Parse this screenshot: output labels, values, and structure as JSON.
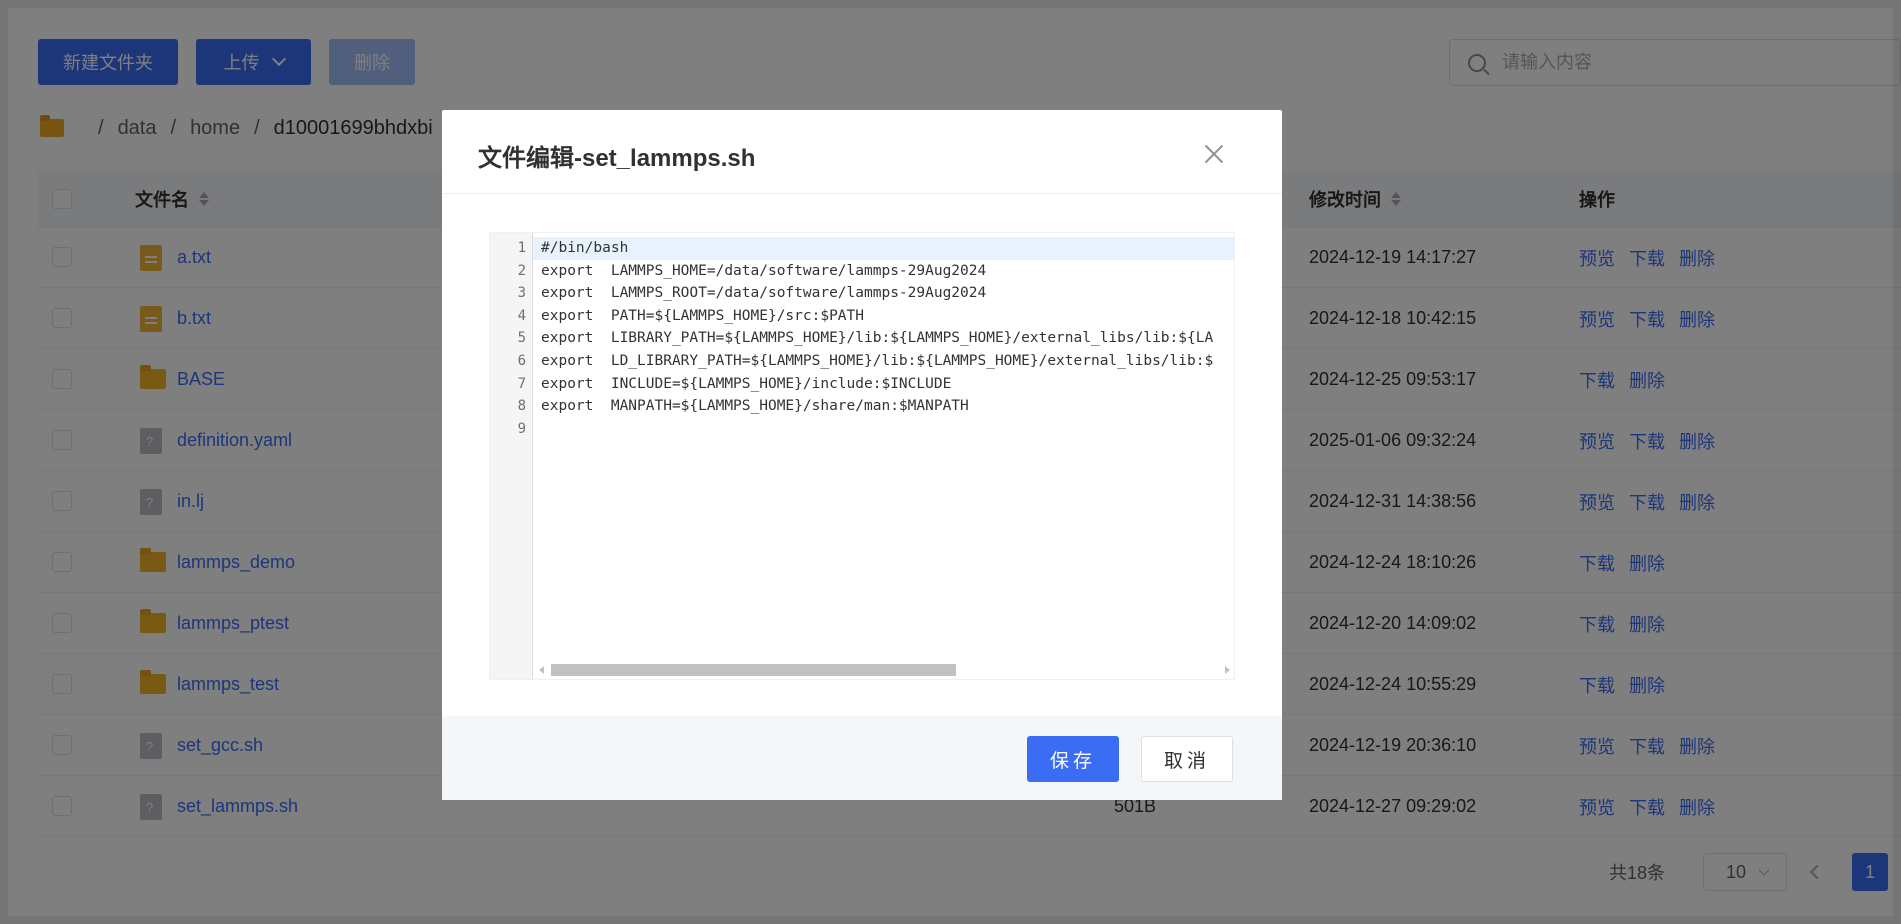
{
  "toolbar": {
    "new_folder_label": "新建文件夹",
    "upload_label": "上传",
    "delete_label": "删除",
    "search_placeholder": "请输入内容"
  },
  "breadcrumb": {
    "items": [
      "data",
      "home",
      "d10001699bhdxbi"
    ]
  },
  "table": {
    "headers": {
      "name": "文件名",
      "modified": "修改时间",
      "actions": "操作"
    },
    "rows": [
      {
        "name": "a.txt",
        "type": "file",
        "size": "",
        "time": "2024-12-19 14:17:27",
        "ops": [
          "预览",
          "下载",
          "删除"
        ]
      },
      {
        "name": "b.txt",
        "type": "file",
        "size": "",
        "time": "2024-12-18 10:42:15",
        "ops": [
          "预览",
          "下载",
          "删除"
        ]
      },
      {
        "name": "BASE",
        "type": "folder",
        "size": "",
        "time": "2024-12-25 09:53:17",
        "ops": [
          "下载",
          "删除"
        ]
      },
      {
        "name": "definition.yaml",
        "type": "unknown",
        "size": "",
        "time": "2025-01-06 09:32:24",
        "ops": [
          "预览",
          "下载",
          "删除"
        ]
      },
      {
        "name": "in.lj",
        "type": "unknown",
        "size": "",
        "time": "2024-12-31 14:38:56",
        "ops": [
          "预览",
          "下载",
          "删除"
        ]
      },
      {
        "name": "lammps_demo",
        "type": "folder",
        "size": "",
        "time": "2024-12-24 18:10:26",
        "ops": [
          "下载",
          "删除"
        ]
      },
      {
        "name": "lammps_ptest",
        "type": "folder",
        "size": "",
        "time": "2024-12-20 14:09:02",
        "ops": [
          "下载",
          "删除"
        ]
      },
      {
        "name": "lammps_test",
        "type": "folder",
        "size": "",
        "time": "2024-12-24 10:55:29",
        "ops": [
          "下载",
          "删除"
        ]
      },
      {
        "name": "set_gcc.sh",
        "type": "unknown",
        "size": "",
        "time": "2024-12-19 20:36:10",
        "ops": [
          "预览",
          "下载",
          "删除"
        ]
      },
      {
        "name": "set_lammps.sh",
        "type": "unknown",
        "size": "501B",
        "time": "2024-12-27 09:29:02",
        "ops": [
          "预览",
          "下载",
          "删除"
        ]
      }
    ]
  },
  "pagination": {
    "total": "共18条",
    "page_size": "10",
    "current": "1"
  },
  "dialog": {
    "title": "文件编辑-set_lammps.sh",
    "code_lines": [
      "#/bin/bash",
      "export  LAMMPS_HOME=/data/software/lammps-29Aug2024",
      "export  LAMMPS_ROOT=/data/software/lammps-29Aug2024",
      "export  PATH=${LAMMPS_HOME}/src:$PATH",
      "export  LIBRARY_PATH=${LAMMPS_HOME}/lib:${LAMMPS_HOME}/external_libs/lib:${LA",
      "export  LD_LIBRARY_PATH=${LAMMPS_HOME}/lib:${LAMMPS_HOME}/external_libs/lib:$",
      "export  INCLUDE=${LAMMPS_HOME}/include:$INCLUDE",
      "export  MANPATH=${LAMMPS_HOME}/share/man:$MANPATH",
      ""
    ],
    "line_numbers": [
      "1",
      "2",
      "3",
      "4",
      "5",
      "6",
      "7",
      "8",
      "9"
    ],
    "save_label": "保存",
    "cancel_label": "取消"
  }
}
